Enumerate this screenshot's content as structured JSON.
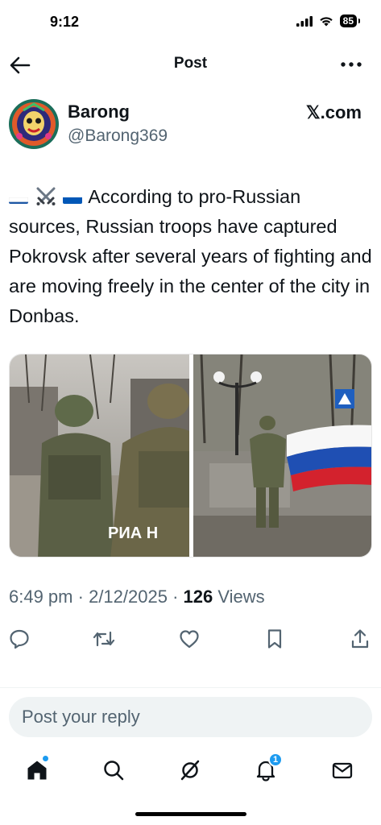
{
  "status_bar": {
    "time": "9:12",
    "battery": "85",
    "icons": [
      "cellular-signal-icon",
      "wifi-icon",
      "battery-icon"
    ]
  },
  "header": {
    "title": "Post",
    "back_icon": "arrow-left-icon",
    "more_icon": "more-horizontal-icon"
  },
  "author": {
    "name": "Barong",
    "handle": "@Barong369",
    "source": "𝕏.com"
  },
  "tweet": {
    "text": "According to pro-Russian sources, Russian troops have captured Pokrovsk after several years of fighting and are moving freely in the center of the city in Donbas.",
    "emoji_prefix": [
      "russia-flag",
      "crossed-swords",
      "ukraine-flag"
    ],
    "media": [
      {
        "name": "soldiers-photo",
        "watermark": "РИА Н"
      },
      {
        "name": "flag-photo"
      }
    ]
  },
  "meta": {
    "time": "6:49 pm",
    "date": "2/12/2025",
    "separator": "·",
    "views_count": "126",
    "views_label": "Views"
  },
  "actions": [
    "reply-icon",
    "retweet-icon",
    "like-icon",
    "bookmark-icon",
    "share-icon"
  ],
  "reply": {
    "placeholder": "Post your reply"
  },
  "tab_bar": {
    "tabs": [
      "home-icon",
      "search-icon",
      "grok-icon",
      "notifications-icon",
      "messages-icon"
    ],
    "notification_count": "1"
  },
  "colors": {
    "accent": "#1d9bf0",
    "text_primary": "#0f1419",
    "text_secondary": "#536471",
    "reply_bg": "#eff3f4"
  }
}
